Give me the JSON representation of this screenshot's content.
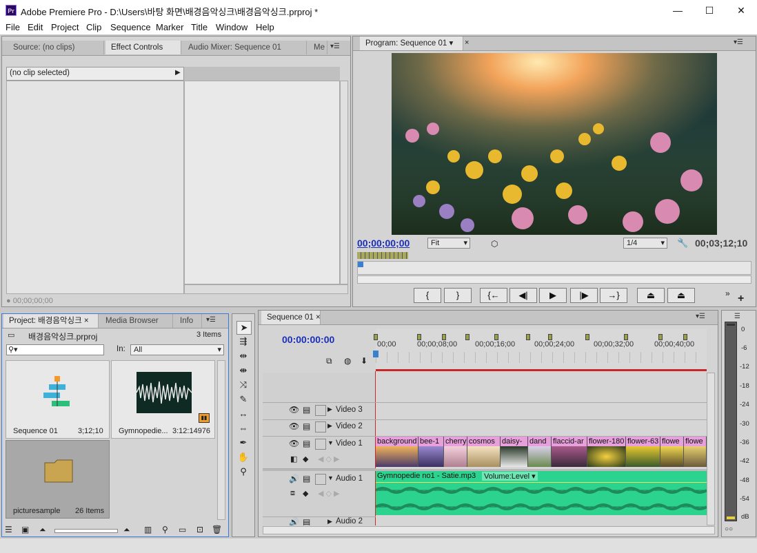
{
  "window": {
    "title": "Adobe Premiere Pro - D:\\Users\\바탕 화면\\배경음악싱크\\배경음악싱크.prproj *",
    "app_icon_label": "Pr",
    "controls": {
      "minimize": "—",
      "maximize": "☐",
      "close": "✕"
    }
  },
  "menu": [
    "File",
    "Edit",
    "Project",
    "Clip",
    "Sequence",
    "Marker",
    "Title",
    "Window",
    "Help"
  ],
  "source_panel": {
    "tabs": [
      "Source: (no clips)",
      "Effect Controls",
      "Audio Mixer: Sequence 01",
      "Me"
    ],
    "clip_header": "(no clip selected)",
    "timecode": "00;00;00;00"
  },
  "program": {
    "tab": "Program: Sequence 01",
    "timecode_left": "00;00;00;00",
    "fit": "Fit",
    "resolution": "1/4",
    "timecode_right": "00;03;12;10",
    "buttons": [
      "{",
      "}",
      "{←",
      "◀|",
      "▶",
      "|▶",
      "→}",
      "⏏",
      "⏏"
    ]
  },
  "project": {
    "tabs": [
      "Project: 배경음악싱크",
      "Media Browser",
      "Info"
    ],
    "file": "배경음악싱크.prproj",
    "count": "3 Items",
    "search_placeholder": "",
    "in_label": "In:",
    "in_value": "All",
    "items": [
      {
        "name": "Sequence 01",
        "meta": "3;12;10"
      },
      {
        "name": "Gymnopedie...",
        "meta": "3:12:14976"
      },
      {
        "name": "picturesample",
        "meta": "26 Items"
      }
    ]
  },
  "timeline": {
    "tab": "Sequence 01",
    "timecode": "00:00:00:00",
    "ruler": [
      "00;00",
      "00;00;08;00",
      "00;00;16;00",
      "00;00;24;00",
      "00;00;32;00",
      "00;00;40;00"
    ],
    "tracks": {
      "v3": "Video 3",
      "v2": "Video 2",
      "v1": "Video 1",
      "a1": "Audio 1",
      "a2": "Audio 2"
    },
    "video_clips": [
      "background",
      "bee-1",
      "cherry",
      "cosmos",
      "daisy-",
      "dand",
      "flaccid-ar",
      "flower-180",
      "flower-63",
      "flowe",
      "flowe"
    ],
    "audio_clip": "Gymnopedie no1 - Satie.mp3",
    "audio_volume": "Volume:Level"
  },
  "meter": {
    "labels": [
      "0",
      "-6",
      "-12",
      "-18",
      "-24",
      "-30",
      "-36",
      "-42",
      "-48",
      "-54",
      "dB"
    ]
  },
  "tools": [
    "selection-tool",
    "track-select-tool",
    "ripple-edit-tool",
    "rolling-edit-tool",
    "rate-stretch-tool",
    "razor-tool",
    "slip-tool",
    "slide-tool",
    "pen-tool",
    "hand-tool",
    "zoom-tool"
  ]
}
